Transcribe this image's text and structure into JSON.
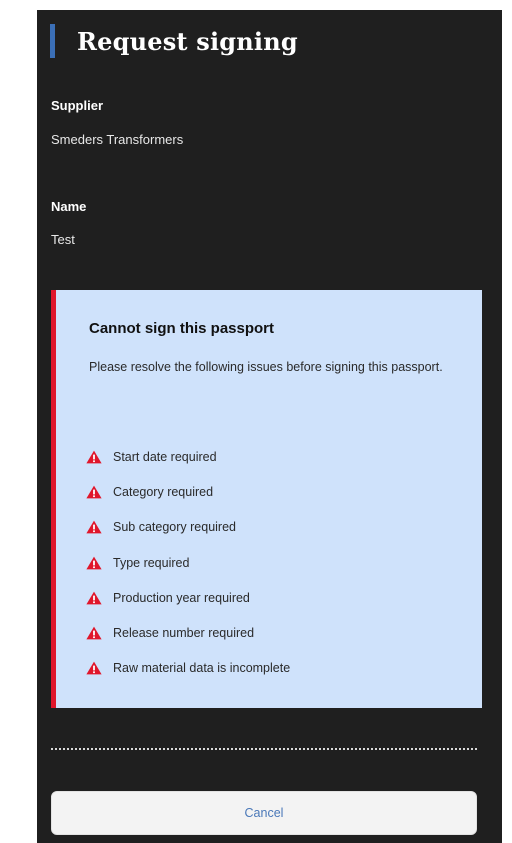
{
  "dialog": {
    "title": "Request signing",
    "accent_color": "#3b6fb6"
  },
  "fields": [
    {
      "label": "Supplier",
      "value": "Smeders Transformers"
    },
    {
      "label": "Name",
      "value": "Test"
    }
  ],
  "alert": {
    "title": "Cannot sign this passport",
    "description": "Please resolve the following issues before signing this passport.",
    "background_color": "#cfe2fb",
    "border_color": "#e0162b",
    "icon": "warning-triangle-icon",
    "issues": [
      "Start date required",
      "Category required",
      "Sub category required",
      "Type required",
      "Production year required",
      "Release number required",
      "Raw material data is incomplete"
    ]
  },
  "actions": {
    "cancel_label": "Cancel"
  }
}
